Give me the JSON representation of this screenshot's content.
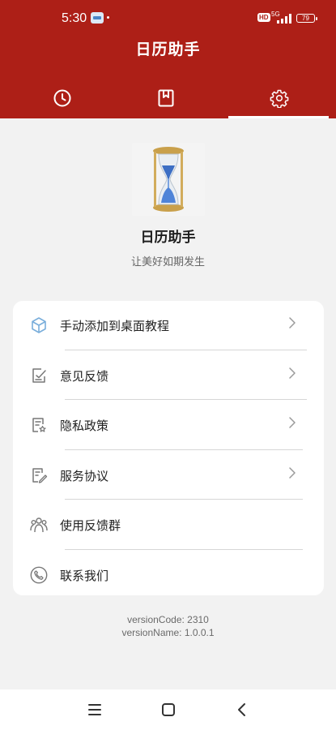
{
  "status_bar": {
    "time": "5:30",
    "hd": "HD",
    "network": "5G",
    "battery": "79"
  },
  "header": {
    "title": "日历助手",
    "tabs": [
      {
        "icon": "clock-icon",
        "active": false
      },
      {
        "icon": "bookmark-icon",
        "active": false
      },
      {
        "icon": "gear-icon",
        "active": true
      }
    ]
  },
  "profile": {
    "logo": "hourglass-logo",
    "name": "日历助手",
    "slogan": "让美好如期发生"
  },
  "menu": {
    "items": [
      {
        "label": "手动添加到桌面教程",
        "icon": "cube-icon",
        "chevron": true
      },
      {
        "label": "意见反馈",
        "icon": "edit-note-icon",
        "chevron": true
      },
      {
        "label": "隐私政策",
        "icon": "privacy-document-icon",
        "chevron": true
      },
      {
        "label": "服务协议",
        "icon": "agreement-document-icon",
        "chevron": true
      },
      {
        "label": "使用反馈群",
        "icon": "group-icon",
        "chevron": false
      },
      {
        "label": "联系我们",
        "icon": "phone-icon",
        "chevron": false
      }
    ]
  },
  "version": {
    "code": "versionCode: 2310",
    "name": "versionName: 1.0.0.1"
  },
  "nav_bar": {
    "buttons": [
      "menu-icon",
      "home-icon",
      "back-icon"
    ]
  },
  "colors": {
    "header_bg": "#ad1f17",
    "page_bg": "#f2f2f2",
    "card_bg": "#ffffff",
    "icon_blue": "#7aaedb"
  }
}
